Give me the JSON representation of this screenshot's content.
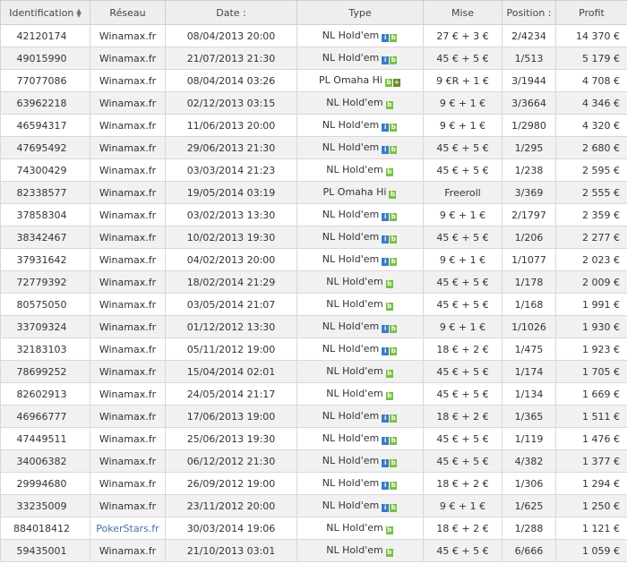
{
  "columns": [
    {
      "label": "Identification",
      "sort": true
    },
    {
      "label": "Réseau"
    },
    {
      "label": "Date :"
    },
    {
      "label": "Type"
    },
    {
      "label": "Mise"
    },
    {
      "label": "Position :"
    },
    {
      "label": "Profit"
    }
  ],
  "rows": [
    {
      "id": "42120174",
      "network": "Winamax.fr",
      "date": "08/04/2013 20:00",
      "type": "NL Hold'em",
      "icons": [
        "blue",
        "green"
      ],
      "buyin": "27 € + 3 €",
      "position": "2/4234",
      "profit": "14 370 €"
    },
    {
      "id": "49015990",
      "network": "Winamax.fr",
      "date": "21/07/2013 21:30",
      "type": "NL Hold'em",
      "icons": [
        "blue",
        "green"
      ],
      "buyin": "45 € + 5 €",
      "position": "1/513",
      "profit": "5 179 €"
    },
    {
      "id": "77077086",
      "network": "Winamax.fr",
      "date": "08/04/2014 03:26",
      "type": "PL Omaha Hi",
      "icons": [
        "green",
        "cross"
      ],
      "buyin": "9 €R + 1 €",
      "position": "3/1944",
      "profit": "4 708 €"
    },
    {
      "id": "63962218",
      "network": "Winamax.fr",
      "date": "02/12/2013 03:15",
      "type": "NL Hold'em",
      "icons": [
        "green"
      ],
      "buyin": "9 € + 1 €",
      "position": "3/3664",
      "profit": "4 346 €"
    },
    {
      "id": "46594317",
      "network": "Winamax.fr",
      "date": "11/06/2013 20:00",
      "type": "NL Hold'em",
      "icons": [
        "blue",
        "green"
      ],
      "buyin": "9 € + 1 €",
      "position": "1/2980",
      "profit": "4 320 €"
    },
    {
      "id": "47695492",
      "network": "Winamax.fr",
      "date": "29/06/2013 21:30",
      "type": "NL Hold'em",
      "icons": [
        "blue",
        "green"
      ],
      "buyin": "45 € + 5 €",
      "position": "1/295",
      "profit": "2 680 €"
    },
    {
      "id": "74300429",
      "network": "Winamax.fr",
      "date": "03/03/2014 21:23",
      "type": "NL Hold'em",
      "icons": [
        "green"
      ],
      "buyin": "45 € + 5 €",
      "position": "1/238",
      "profit": "2 595 €"
    },
    {
      "id": "82338577",
      "network": "Winamax.fr",
      "date": "19/05/2014 03:19",
      "type": "PL Omaha Hi",
      "icons": [
        "green"
      ],
      "buyin": "Freeroll",
      "position": "3/369",
      "profit": "2 555 €"
    },
    {
      "id": "37858304",
      "network": "Winamax.fr",
      "date": "03/02/2013 13:30",
      "type": "NL Hold'em",
      "icons": [
        "blue",
        "green"
      ],
      "buyin": "9 € + 1 €",
      "position": "2/1797",
      "profit": "2 359 €"
    },
    {
      "id": "38342467",
      "network": "Winamax.fr",
      "date": "10/02/2013 19:30",
      "type": "NL Hold'em",
      "icons": [
        "blue",
        "green"
      ],
      "buyin": "45 € + 5 €",
      "position": "1/206",
      "profit": "2 277 €"
    },
    {
      "id": "37931642",
      "network": "Winamax.fr",
      "date": "04/02/2013 20:00",
      "type": "NL Hold'em",
      "icons": [
        "blue",
        "green"
      ],
      "buyin": "9 € + 1 €",
      "position": "1/1077",
      "profit": "2 023 €"
    },
    {
      "id": "72779392",
      "network": "Winamax.fr",
      "date": "18/02/2014 21:29",
      "type": "NL Hold'em",
      "icons": [
        "green"
      ],
      "buyin": "45 € + 5 €",
      "position": "1/178",
      "profit": "2 009 €"
    },
    {
      "id": "80575050",
      "network": "Winamax.fr",
      "date": "03/05/2014 21:07",
      "type": "NL Hold'em",
      "icons": [
        "green"
      ],
      "buyin": "45 € + 5 €",
      "position": "1/168",
      "profit": "1 991 €"
    },
    {
      "id": "33709324",
      "network": "Winamax.fr",
      "date": "01/12/2012 13:30",
      "type": "NL Hold'em",
      "icons": [
        "blue",
        "green"
      ],
      "buyin": "9 € + 1 €",
      "position": "1/1026",
      "profit": "1 930 €"
    },
    {
      "id": "32183103",
      "network": "Winamax.fr",
      "date": "05/11/2012 19:00",
      "type": "NL Hold'em",
      "icons": [
        "blue",
        "green"
      ],
      "buyin": "18 € + 2 €",
      "position": "1/475",
      "profit": "1 923 €"
    },
    {
      "id": "78699252",
      "network": "Winamax.fr",
      "date": "15/04/2014 02:01",
      "type": "NL Hold'em",
      "icons": [
        "green"
      ],
      "buyin": "45 € + 5 €",
      "position": "1/174",
      "profit": "1 705 €"
    },
    {
      "id": "82602913",
      "network": "Winamax.fr",
      "date": "24/05/2014 21:17",
      "type": "NL Hold'em",
      "icons": [
        "green"
      ],
      "buyin": "45 € + 5 €",
      "position": "1/134",
      "profit": "1 669 €"
    },
    {
      "id": "46966777",
      "network": "Winamax.fr",
      "date": "17/06/2013 19:00",
      "type": "NL Hold'em",
      "icons": [
        "blue",
        "green"
      ],
      "buyin": "18 € + 2 €",
      "position": "1/365",
      "profit": "1 511 €"
    },
    {
      "id": "47449511",
      "network": "Winamax.fr",
      "date": "25/06/2013 19:30",
      "type": "NL Hold'em",
      "icons": [
        "blue",
        "green"
      ],
      "buyin": "45 € + 5 €",
      "position": "1/119",
      "profit": "1 476 €"
    },
    {
      "id": "34006382",
      "network": "Winamax.fr",
      "date": "06/12/2012 21:30",
      "type": "NL Hold'em",
      "icons": [
        "blue",
        "green"
      ],
      "buyin": "45 € + 5 €",
      "position": "4/382",
      "profit": "1 377 €"
    },
    {
      "id": "29994680",
      "network": "Winamax.fr",
      "date": "26/09/2012 19:00",
      "type": "NL Hold'em",
      "icons": [
        "blue",
        "green"
      ],
      "buyin": "18 € + 2 €",
      "position": "1/306",
      "profit": "1 294 €"
    },
    {
      "id": "33235009",
      "network": "Winamax.fr",
      "date": "23/11/2012 20:00",
      "type": "NL Hold'em",
      "icons": [
        "blue",
        "green"
      ],
      "buyin": "9 € + 1 €",
      "position": "1/625",
      "profit": "1 250 €"
    },
    {
      "id": "884018412",
      "network": "PokerStars.fr",
      "date": "30/03/2014 19:06",
      "type": "NL Hold'em",
      "icons": [
        "green"
      ],
      "buyin": "18 € + 2 €",
      "position": "1/288",
      "profit": "1 121 €",
      "link": true
    },
    {
      "id": "59435001",
      "network": "Winamax.fr",
      "date": "21/10/2013 03:01",
      "type": "NL Hold'em",
      "icons": [
        "green"
      ],
      "buyin": "45 € + 5 €",
      "position": "6/666",
      "profit": "1 059 €"
    }
  ],
  "icon_names": {
    "blue": "multi-table-icon",
    "green": "tournament-icon",
    "cross": "rebuy-icon"
  },
  "colors": {
    "header_bg": "#eeeeee",
    "row_alt": "#f1f1f1",
    "link": "#4a6fa5",
    "icon_blue": "#3a7cc4",
    "icon_green": "#79c142"
  }
}
